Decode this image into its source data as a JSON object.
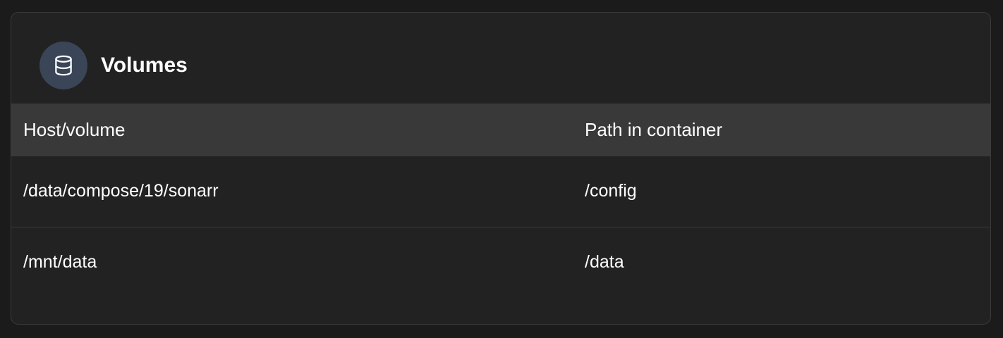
{
  "volumes": {
    "title": "Volumes",
    "icon": "database-icon",
    "icon_badge_color": "#3a4558",
    "columns": [
      "Host/volume",
      "Path in container"
    ],
    "rows": [
      {
        "host": "/data/compose/19/sonarr",
        "container_path": "/config"
      },
      {
        "host": "/mnt/data",
        "container_path": "/data"
      }
    ]
  }
}
